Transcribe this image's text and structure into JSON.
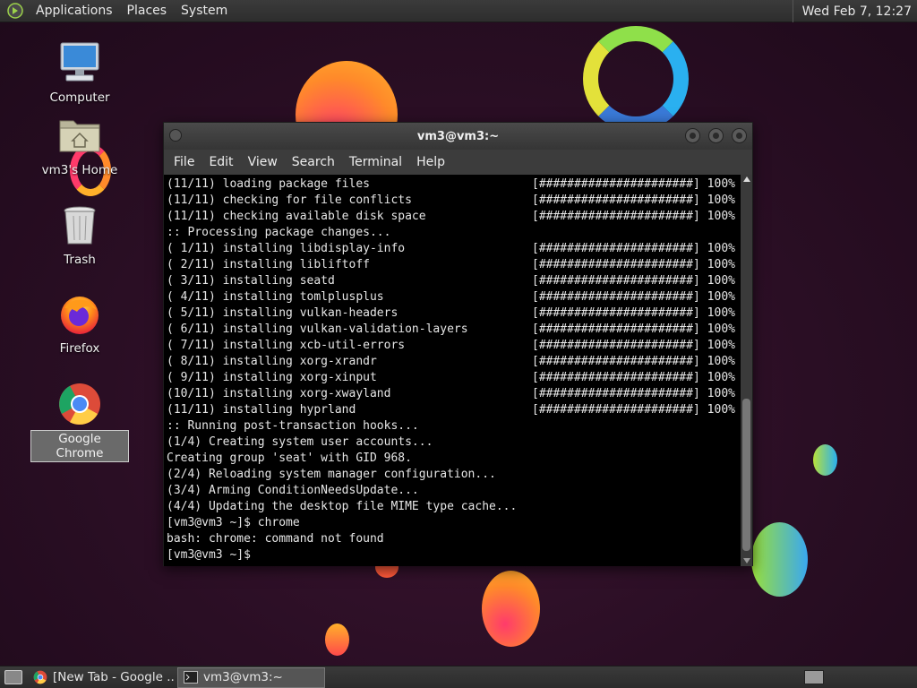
{
  "top_panel": {
    "menus": [
      "Applications",
      "Places",
      "System"
    ],
    "clock": "Wed Feb  7, 12:27"
  },
  "desktop_icons": [
    {
      "label": "Computer",
      "icon": "computer-icon"
    },
    {
      "label": "vm3's Home",
      "icon": "home-folder-icon"
    },
    {
      "label": "Trash",
      "icon": "trash-icon"
    },
    {
      "label": "Firefox",
      "icon": "firefox-icon"
    },
    {
      "label": "Google Chrome",
      "icon": "chrome-icon",
      "selected": true
    }
  ],
  "terminal": {
    "title": "vm3@vm3:~",
    "menu": [
      "File",
      "Edit",
      "View",
      "Search",
      "Terminal",
      "Help"
    ],
    "lines": [
      {
        "text": "(11/11) loading package files",
        "progress": "[######################] 100%"
      },
      {
        "text": "(11/11) checking for file conflicts",
        "progress": "[######################] 100%"
      },
      {
        "text": "(11/11) checking available disk space",
        "progress": "[######################] 100%"
      },
      {
        "text": ":: Processing package changes...",
        "progress": ""
      },
      {
        "text": "( 1/11) installing libdisplay-info",
        "progress": "[######################] 100%"
      },
      {
        "text": "( 2/11) installing libliftoff",
        "progress": "[######################] 100%"
      },
      {
        "text": "( 3/11) installing seatd",
        "progress": "[######################] 100%"
      },
      {
        "text": "( 4/11) installing tomlplusplus",
        "progress": "[######################] 100%"
      },
      {
        "text": "( 5/11) installing vulkan-headers",
        "progress": "[######################] 100%"
      },
      {
        "text": "( 6/11) installing vulkan-validation-layers",
        "progress": "[######################] 100%"
      },
      {
        "text": "( 7/11) installing xcb-util-errors",
        "progress": "[######################] 100%"
      },
      {
        "text": "( 8/11) installing xorg-xrandr",
        "progress": "[######################] 100%"
      },
      {
        "text": "( 9/11) installing xorg-xinput",
        "progress": "[######################] 100%"
      },
      {
        "text": "(10/11) installing xorg-xwayland",
        "progress": "[######################] 100%"
      },
      {
        "text": "(11/11) installing hyprland",
        "progress": "[######################] 100%"
      },
      {
        "text": ":: Running post-transaction hooks...",
        "progress": ""
      },
      {
        "text": "(1/4) Creating system user accounts...",
        "progress": ""
      },
      {
        "text": "Creating group 'seat' with GID 968.",
        "progress": ""
      },
      {
        "text": "(2/4) Reloading system manager configuration...",
        "progress": ""
      },
      {
        "text": "(3/4) Arming ConditionNeedsUpdate...",
        "progress": ""
      },
      {
        "text": "(4/4) Updating the desktop file MIME type cache...",
        "progress": ""
      },
      {
        "text": "[vm3@vm3 ~]$ chrome",
        "progress": ""
      },
      {
        "text": "bash: chrome: command not found",
        "progress": ""
      }
    ],
    "prompt": "[vm3@vm3 ~]$ "
  },
  "taskbar": {
    "tasks": [
      {
        "label": "[New Tab - Google ...",
        "icon": "chrome-icon",
        "active": false
      },
      {
        "label": "vm3@vm3:~",
        "icon": "terminal-icon",
        "active": true
      }
    ]
  }
}
